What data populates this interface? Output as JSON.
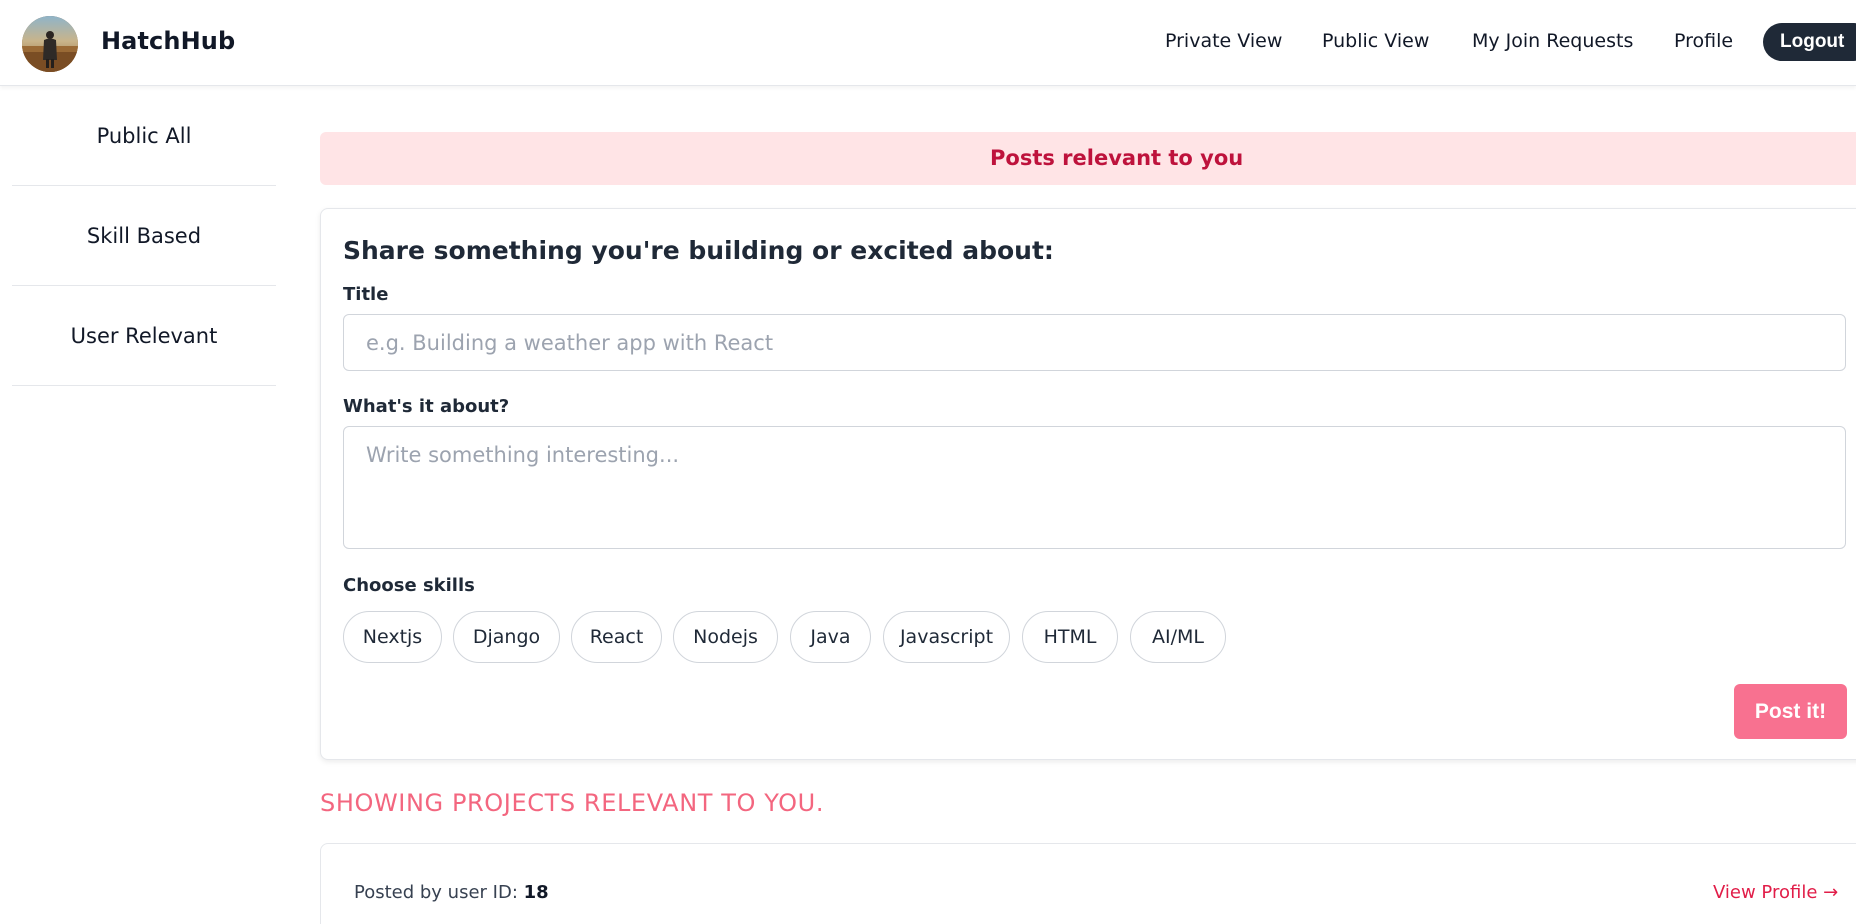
{
  "app": {
    "brand": "HatchHub"
  },
  "nav": {
    "links": [
      "Private View",
      "Public View",
      "My Join Requests",
      "Profile"
    ],
    "logout_label": "Logout"
  },
  "sidebar": {
    "items": [
      {
        "label": "Public All"
      },
      {
        "label": "Skill Based"
      },
      {
        "label": "User Relevant"
      }
    ]
  },
  "banner": {
    "text": "Posts relevant to you"
  },
  "composer": {
    "heading": "Share something you're building or excited about:",
    "title_label": "Title",
    "title_placeholder": "e.g. Building a weather app with React",
    "title_value": "",
    "about_label": "What's it about?",
    "about_placeholder": "Write something interesting...",
    "about_value": "",
    "skills_label": "Choose skills",
    "skills": [
      "Nextjs",
      "Django",
      "React",
      "Nodejs",
      "Java",
      "Javascript",
      "HTML",
      "AI/ML"
    ],
    "submit_label": "Post it!"
  },
  "feed": {
    "heading": "SHOWING PROJECTS RELEVANT TO YOU.",
    "posts": [
      {
        "posted_by_prefix": "Posted by user ID:",
        "user_id": "18",
        "view_profile_label": "View Profile →"
      }
    ]
  },
  "colors": {
    "accent": "#f87190",
    "banner_bg": "#ffe4e6",
    "banner_text": "#be123c",
    "logout_bg": "#1f2937",
    "section_heading": "#f3667f",
    "link": "#e11d48"
  }
}
